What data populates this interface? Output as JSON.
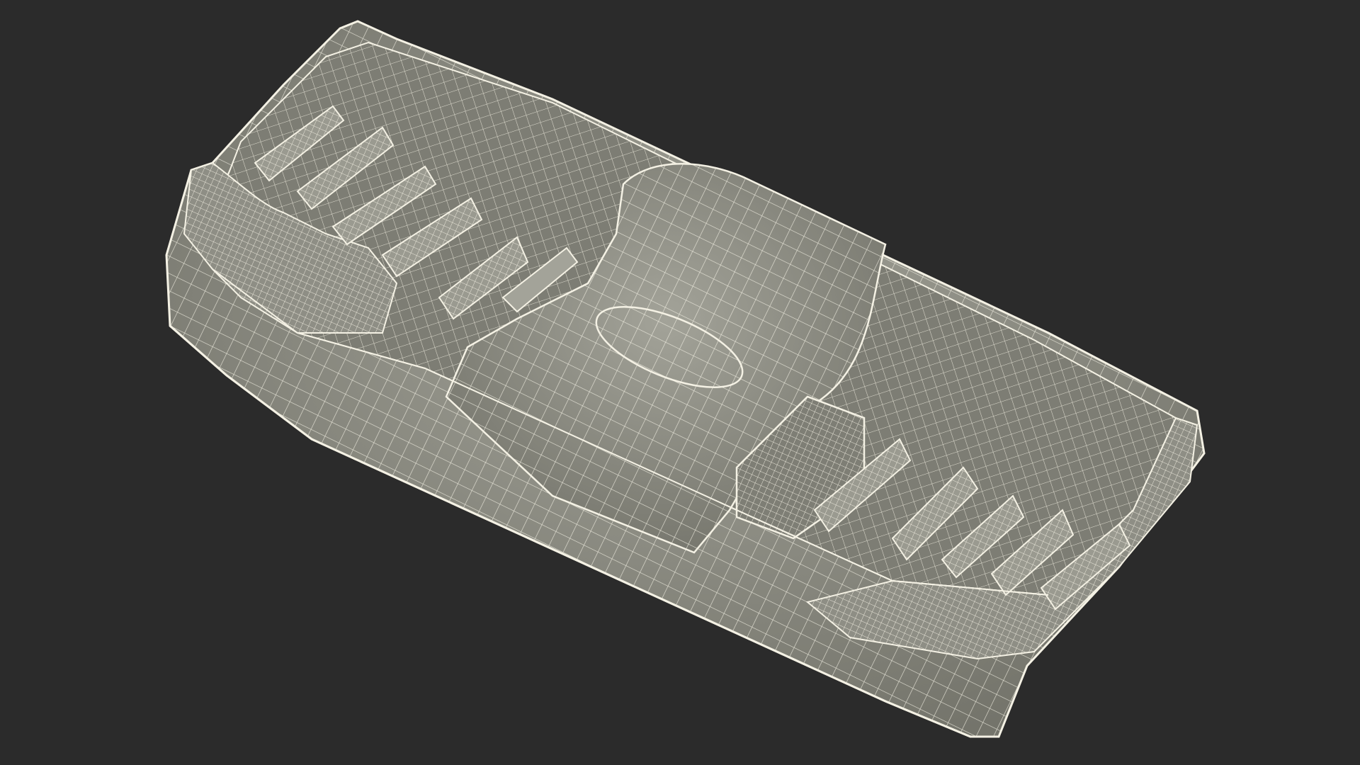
{
  "scene": {
    "subject": "wireframe-3d-model-tray",
    "colors": {
      "background": "#2b2b2b",
      "surface": "#8a8a80",
      "surface_shadow": "#6e6e66",
      "surface_light": "#a3a399",
      "wire": "#f4f1e4"
    }
  }
}
